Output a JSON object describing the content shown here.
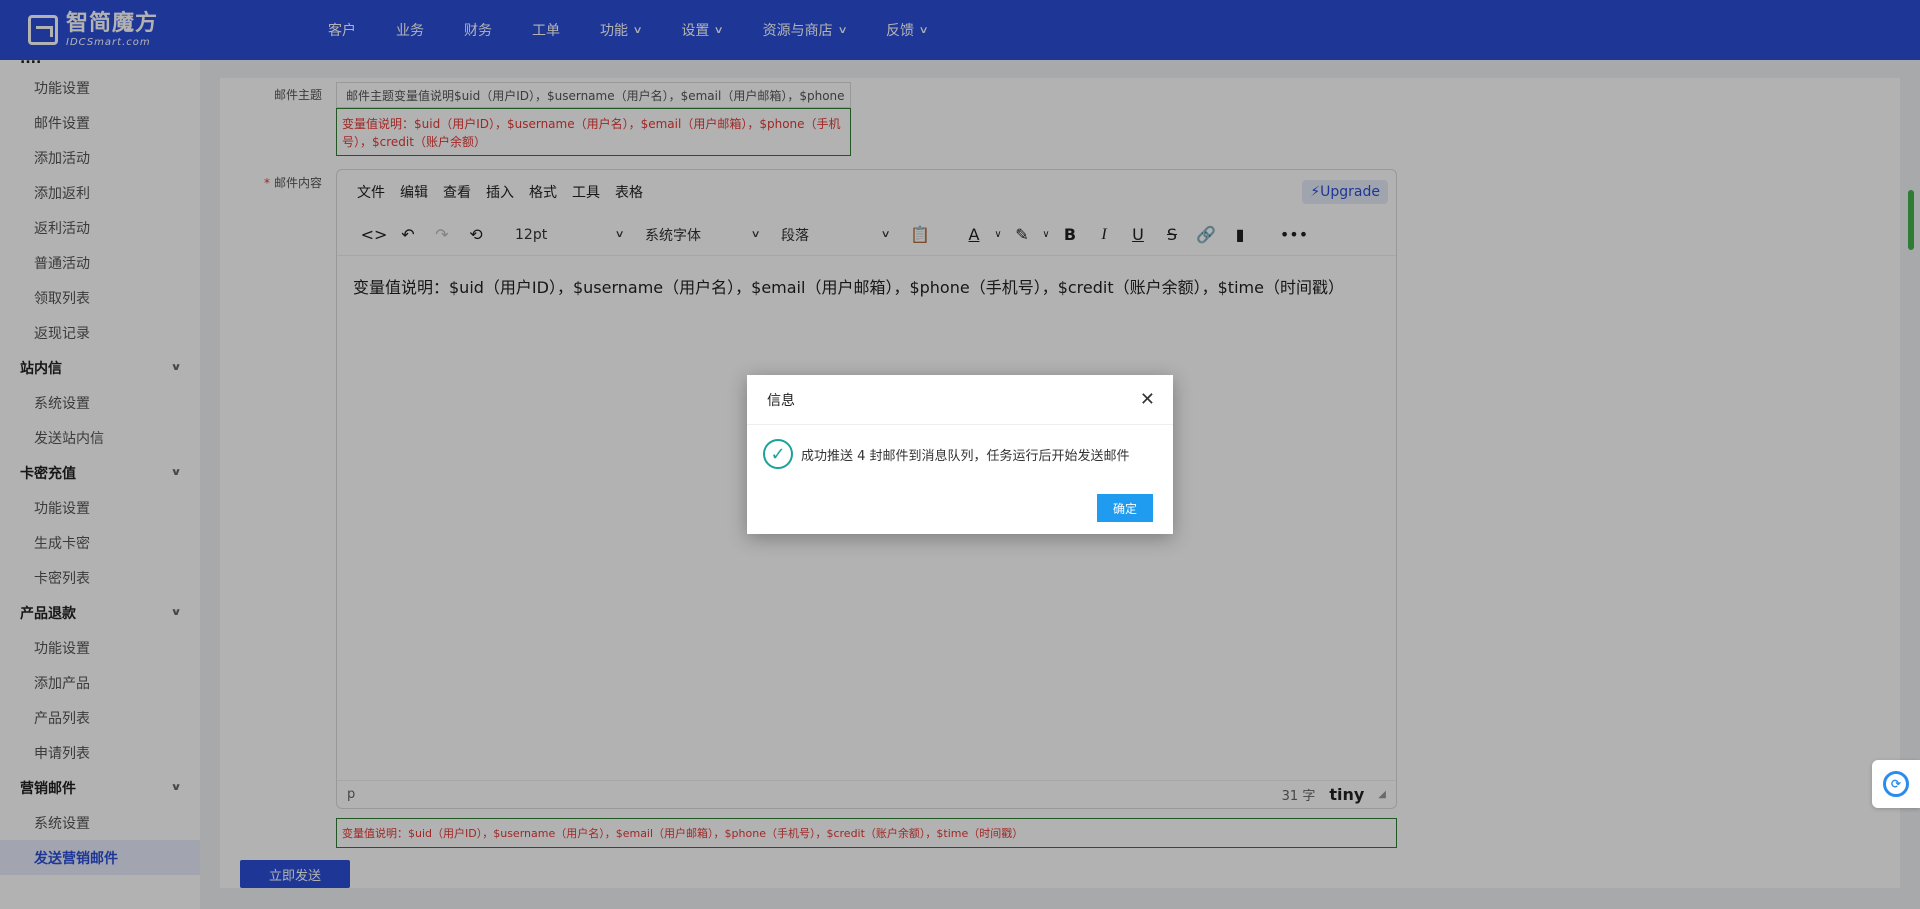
{
  "topbar": {
    "logo_cn": "智简魔方",
    "logo_en": "IDCSmart.com",
    "nav": [
      {
        "label": "客户",
        "dropdown": false
      },
      {
        "label": "业务",
        "dropdown": false
      },
      {
        "label": "财务",
        "dropdown": false
      },
      {
        "label": "工单",
        "dropdown": false
      },
      {
        "label": "功能",
        "dropdown": true
      },
      {
        "label": "设置",
        "dropdown": true
      },
      {
        "label": "资源与商店",
        "dropdown": true
      },
      {
        "label": "反馈",
        "dropdown": true
      }
    ]
  },
  "sidebar": {
    "partial_top": "....",
    "items_a": [
      "功能设置",
      "邮件设置",
      "添加活动",
      "添加返利",
      "返利活动",
      "普通活动",
      "领取列表",
      "返现记录"
    ],
    "group_zhannei": "站内信",
    "items_b": [
      "系统设置",
      "发送站内信"
    ],
    "group_kami": "卡密充值",
    "items_c": [
      "功能设置",
      "生成卡密",
      "卡密列表"
    ],
    "group_tuikuan": "产品退款",
    "items_d": [
      "功能设置",
      "添加产品",
      "产品列表",
      "申请列表"
    ],
    "group_yingxiao": "营销邮件",
    "items_e": [
      "系统设置",
      "发送营销邮件"
    ]
  },
  "form": {
    "subject_label": "邮件主题",
    "subject_value": "邮件主题变量值说明$uid（用户ID），$username（用户名），$email（用户邮箱），$phone",
    "subject_hint": "变量值说明：$uid（用户ID），$username（用户名），$email（用户邮箱），$phone（手机号），$credit（账户余额）",
    "content_label": "邮件内容",
    "content_required": "*",
    "content_hint": "变量值说明：$uid（用户ID），$username（用户名），$email（用户邮箱），$phone（手机号），$credit（账户余额），$time（时间戳）",
    "send_label": "立即发送"
  },
  "editor": {
    "menus": [
      "文件",
      "编辑",
      "查看",
      "插入",
      "格式",
      "工具",
      "表格"
    ],
    "upgrade_label": "⚡Upgrade",
    "font_size": "12pt",
    "font_family": "系统字体",
    "block_format": "段落",
    "body_text": "变量值说明：$uid（用户ID），$username（用户名），$email（用户邮箱），$phone（手机号），$credit（账户余额），$time（时间戳）",
    "status_path": "p",
    "word_count": "31 字",
    "brand": "tiny"
  },
  "dialog": {
    "title": "信息",
    "message": "成功推送 4 封邮件到消息队列，任务运行后开始发送邮件",
    "ok_label": "确定"
  },
  "colors": {
    "brand": "#2b4fd8",
    "success": "#1aa29b",
    "ok_button": "#1f9cf0",
    "hint_text": "#e53935",
    "hint_border": "#2e7d32"
  },
  "icons": {
    "dialog_close": "close-icon",
    "dialog_status": "check-circle-icon"
  }
}
